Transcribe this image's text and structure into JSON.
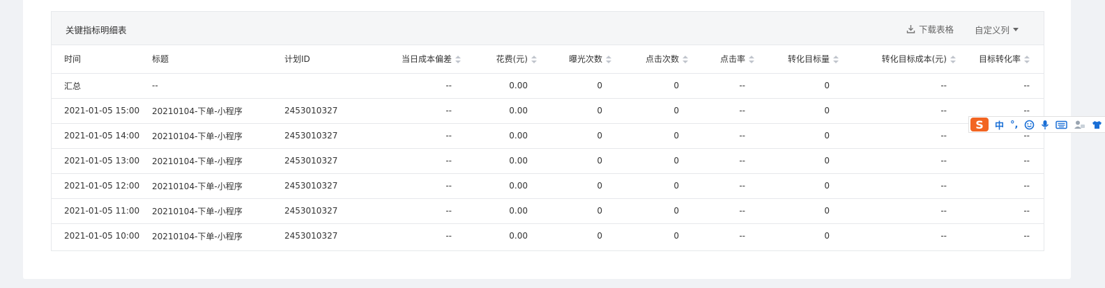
{
  "panel": {
    "title": "关键指标明细表",
    "download_label": "下载表格",
    "custom_columns_label": "自定义列"
  },
  "table": {
    "columns": [
      {
        "label": "时间",
        "sortable": false
      },
      {
        "label": "标题",
        "sortable": false
      },
      {
        "label": "计划ID",
        "sortable": false
      },
      {
        "label": "当日成本偏差",
        "sortable": true
      },
      {
        "label": "花费(元)",
        "sortable": true
      },
      {
        "label": "曝光次数",
        "sortable": true
      },
      {
        "label": "点击次数",
        "sortable": true
      },
      {
        "label": "点击率",
        "sortable": true
      },
      {
        "label": "转化目标量",
        "sortable": true
      },
      {
        "label": "转化目标成本(元)",
        "sortable": true
      },
      {
        "label": "目标转化率",
        "sortable": true
      }
    ],
    "rows": [
      [
        "汇总",
        "--",
        "",
        "--",
        "0.00",
        "0",
        "0",
        "--",
        "0",
        "--",
        "--"
      ],
      [
        "2021-01-05 15:00",
        "20210104-下单-小程序",
        "2453010327",
        "--",
        "0.00",
        "0",
        "0",
        "--",
        "0",
        "--",
        "--"
      ],
      [
        "2021-01-05 14:00",
        "20210104-下单-小程序",
        "2453010327",
        "--",
        "0.00",
        "0",
        "0",
        "--",
        "0",
        "--",
        "--"
      ],
      [
        "2021-01-05 13:00",
        "20210104-下单-小程序",
        "2453010327",
        "--",
        "0.00",
        "0",
        "0",
        "--",
        "0",
        "--",
        "--"
      ],
      [
        "2021-01-05 12:00",
        "20210104-下单-小程序",
        "2453010327",
        "--",
        "0.00",
        "0",
        "0",
        "--",
        "0",
        "--",
        "--"
      ],
      [
        "2021-01-05 11:00",
        "20210104-下单-小程序",
        "2453010327",
        "--",
        "0.00",
        "0",
        "0",
        "--",
        "0",
        "--",
        "--"
      ],
      [
        "2021-01-05 10:00",
        "20210104-下单-小程序",
        "2453010327",
        "--",
        "0.00",
        "0",
        "0",
        "--",
        "0",
        "--",
        "--"
      ]
    ]
  },
  "ime_toolbar": {
    "logo": "S",
    "mode_label": "中",
    "punct_label": "°,",
    "icons": [
      "emoji-icon",
      "microphone-icon",
      "keyboard-icon",
      "user-settings-icon",
      "skin-icon"
    ]
  },
  "colors": {
    "header_bg": "#f5f6f7",
    "border": "#e6e8eb",
    "sorter": "#c0c4cc",
    "ime_brand": "#f26522",
    "ime_blue": "#1a6fd6"
  }
}
